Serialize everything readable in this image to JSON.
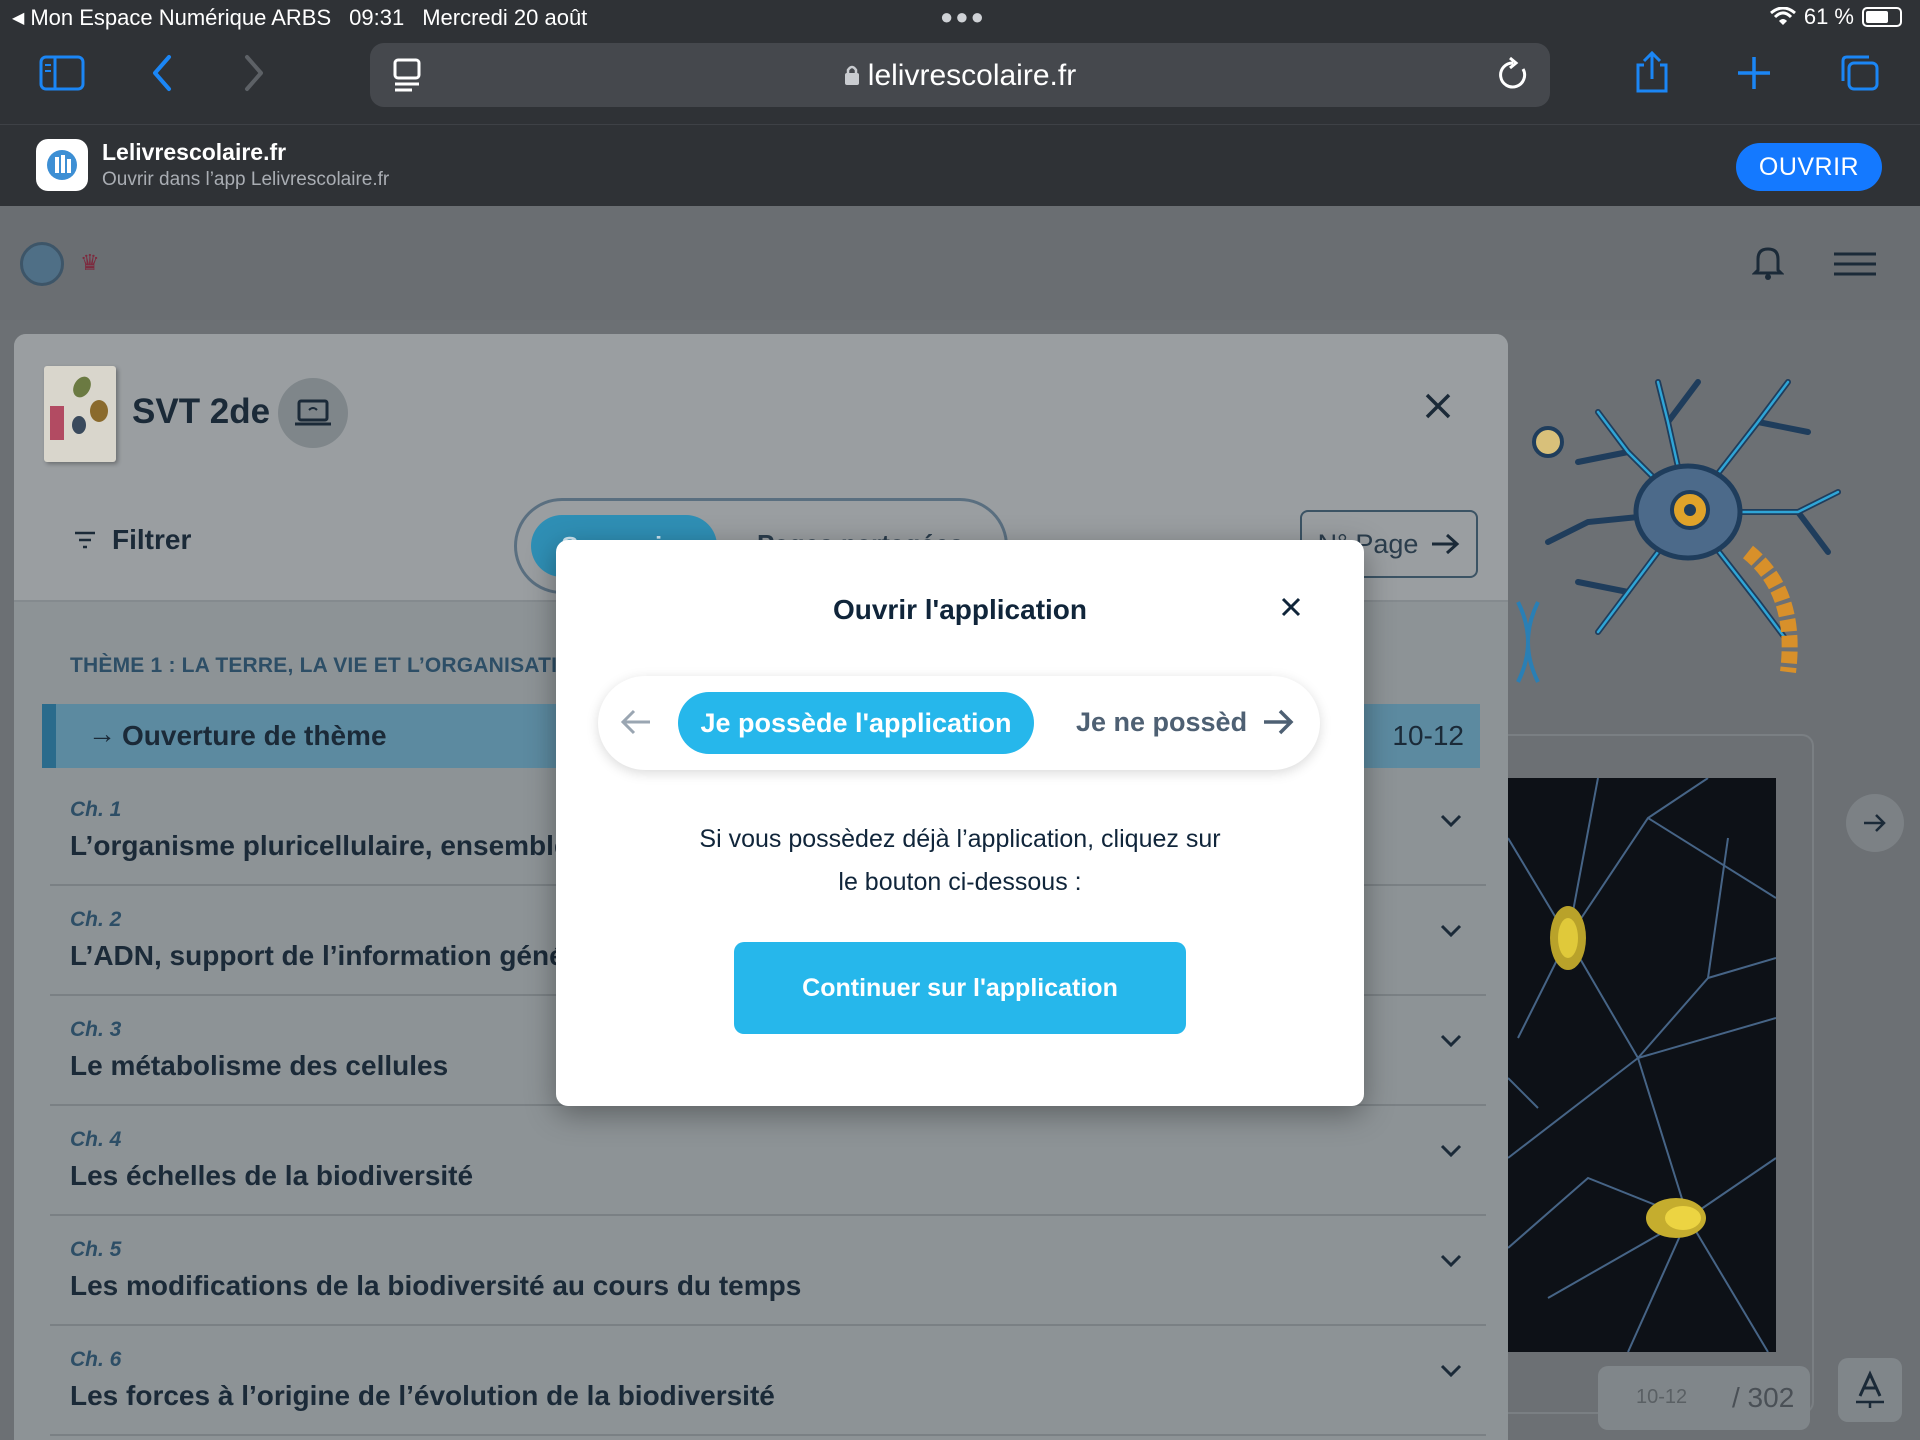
{
  "status_bar": {
    "back_app": "Mon Espace Numérique ARBS",
    "time": "09:31",
    "date": "Mercredi 20 août",
    "battery": "61 %"
  },
  "browser": {
    "url": "lelivrescolaire.fr"
  },
  "app_banner": {
    "name": "Lelivrescolaire.fr",
    "subtitle": "Ouvrir dans l’app Lelivrescolaire.fr",
    "open_label": "OUVRIR"
  },
  "panel": {
    "book_title": "SVT 2de",
    "filter_label": "Filtrer",
    "tab_active": "Sommaire",
    "tab_other": "Pages partagées",
    "page_search": "N° Page",
    "theme_label": "THÈME 1 : LA TERRE, LA VIE ET L’ORGANISATION",
    "theme_row_label": "Ouverture de thème",
    "theme_row_pages": "10-12",
    "chapters": [
      {
        "num": "Ch. 1",
        "title": "L’organisme pluricellulaire, ensemble d"
      },
      {
        "num": "Ch. 2",
        "title": "L’ADN, support de l’information généti"
      },
      {
        "num": "Ch. 3",
        "title": "Le métabolisme des cellules"
      },
      {
        "num": "Ch. 4",
        "title": "Les échelles de la biodiversité"
      },
      {
        "num": "Ch. 5",
        "title": "Les modifications de la biodiversité au cours du temps"
      },
      {
        "num": "Ch. 6",
        "title": "Les forces à l’origine de l’évolution de la biodiversité"
      }
    ]
  },
  "pager": {
    "current": "10-12",
    "total": "/ 302"
  },
  "modal": {
    "title": "Ouvrir l'application",
    "tab_active": "Je possède l'application",
    "tab_other": "Je ne possèd",
    "text_line1": "Si vous possèdez déjà l’application, cliquez sur",
    "text_line2": "le bouton ci-dessous :",
    "cta": "Continuer sur l'application"
  },
  "colors": {
    "accent": "#26b7eb",
    "ios_blue": "#1479ff",
    "text_dark": "#10253a"
  }
}
